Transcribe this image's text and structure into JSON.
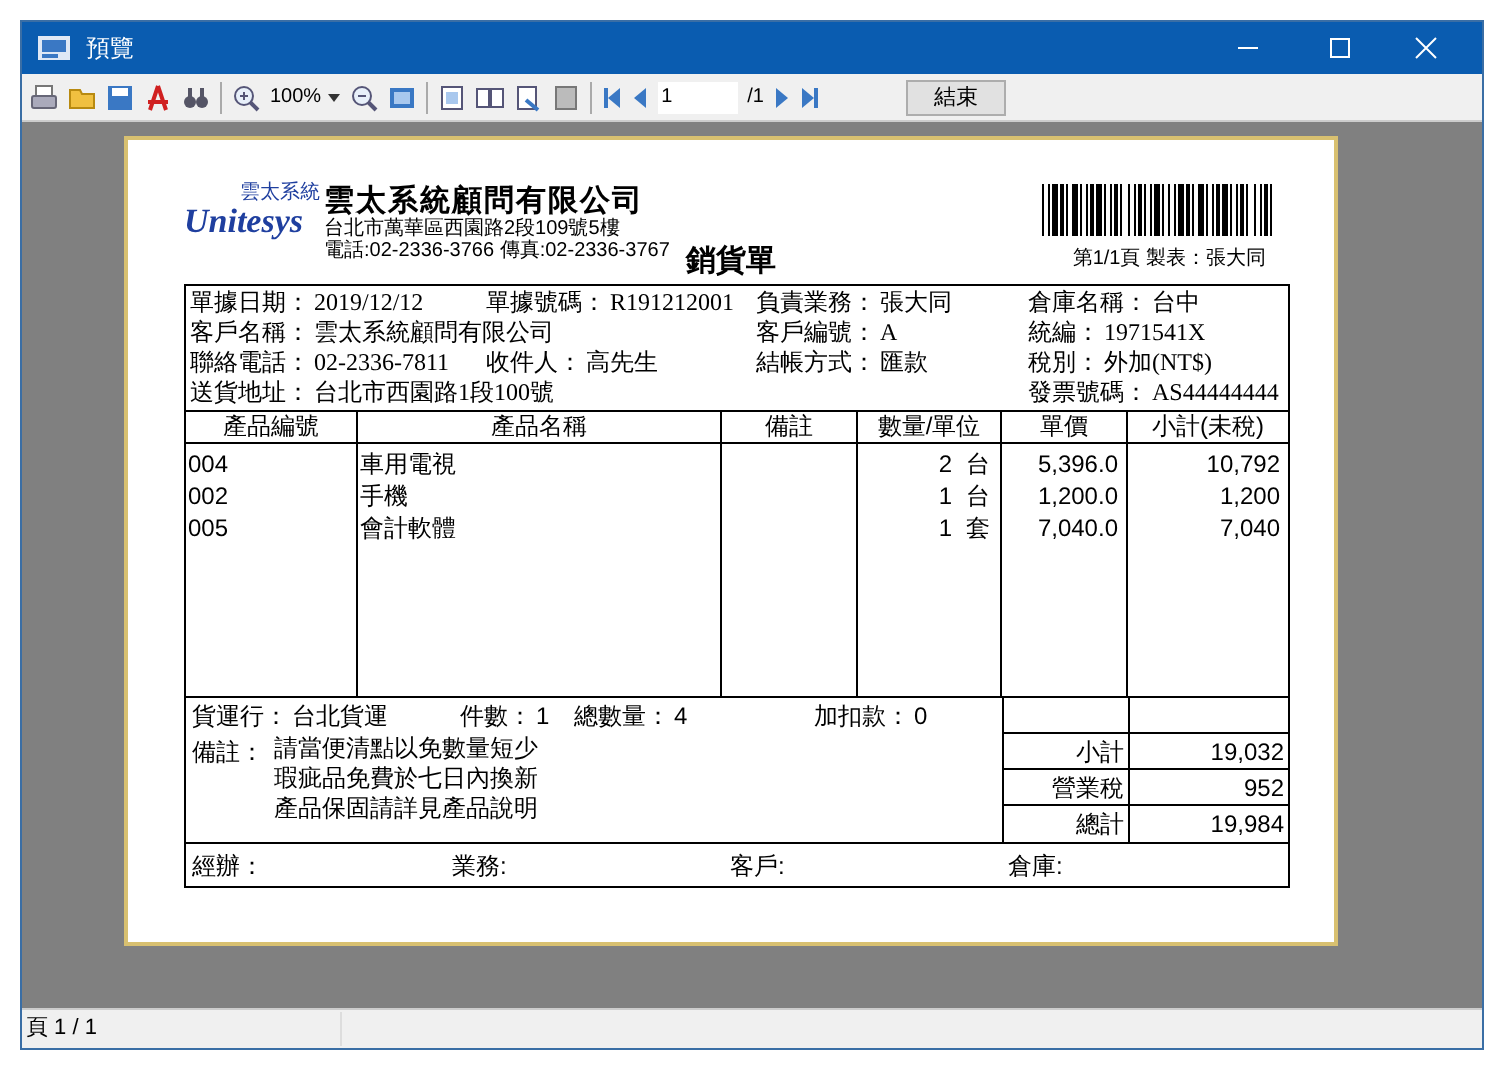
{
  "window": {
    "title": "預覽"
  },
  "toolbar": {
    "zoom": "100%",
    "page_field": "1",
    "page_total": "/1",
    "close_button": "結束"
  },
  "document": {
    "logo": {
      "wordmark": "Unitesys",
      "badge": "雲太系統"
    },
    "company_name": "雲太系統顧問有限公司",
    "address": "台北市萬華區西園路2段109號5樓",
    "contact": "電話:02-2336-3766 傳真:02-2336-3767",
    "title": "銷貨單",
    "page_info": "第1/1頁 製表：張大同",
    "info_rows": [
      [
        {
          "label": "單據日期：",
          "value": "2019/12/12"
        },
        {
          "label": "單據號碼：",
          "value": "R191212001"
        },
        {
          "label": "負責業務：",
          "value": "張大同"
        },
        {
          "label": "倉庫名稱：",
          "value": "台中"
        }
      ],
      [
        {
          "label": "客戶名稱：",
          "value": "雲太系統顧問有限公司"
        },
        {
          "label": "客戶編號：",
          "value": "A"
        },
        {
          "label": "統編：",
          "value": "1971541X"
        }
      ],
      [
        {
          "label": "聯絡電話：",
          "value": "02-2336-7811"
        },
        {
          "label": "收件人：",
          "value": "高先生"
        },
        {
          "label": "結帳方式：",
          "value": "匯款"
        },
        {
          "label": "稅別：",
          "value": "外加(NT$)"
        }
      ],
      [
        {
          "label": "送貨地址：",
          "value": "台北市西園路1段100號"
        },
        {
          "label": "發票號碼：",
          "value": "AS44444444"
        }
      ]
    ],
    "table": {
      "columns": [
        "產品編號",
        "產品名稱",
        "備註",
        "數量/單位",
        "單價",
        "小計(未稅)"
      ],
      "rows": [
        {
          "code": "004",
          "name": "車用電視",
          "qty": "2",
          "unit": "台",
          "price": "5,396.0",
          "subtotal": "10,792"
        },
        {
          "code": "002",
          "name": "手機",
          "qty": "1",
          "unit": "台",
          "price": "1,200.0",
          "subtotal": "1,200"
        },
        {
          "code": "005",
          "name": "會計軟體",
          "qty": "1",
          "unit": "套",
          "price": "7,040.0",
          "subtotal": "7,040"
        }
      ]
    },
    "summary": {
      "stats": [
        {
          "label": "貨運行：",
          "value": "台北貨運"
        },
        {
          "label": "件數：",
          "value": "1"
        },
        {
          "label": "總數量：",
          "value": "4"
        },
        {
          "label": "加扣款：",
          "value": "0"
        }
      ],
      "notes_label": "備註：",
      "notes": [
        "請當便清點以免數量短少",
        "瑕疵品免費於七日內換新",
        "產品保固請詳見產品說明"
      ],
      "totals": [
        {
          "label": "小計",
          "value": "19,032"
        },
        {
          "label": "營業稅",
          "value": "952"
        },
        {
          "label": "總計",
          "value": "19,984"
        }
      ]
    },
    "signatures": [
      "經辦：",
      "業務:",
      "客戶:",
      "倉庫:"
    ]
  },
  "status_bar": {
    "page": "頁 1 / 1"
  }
}
